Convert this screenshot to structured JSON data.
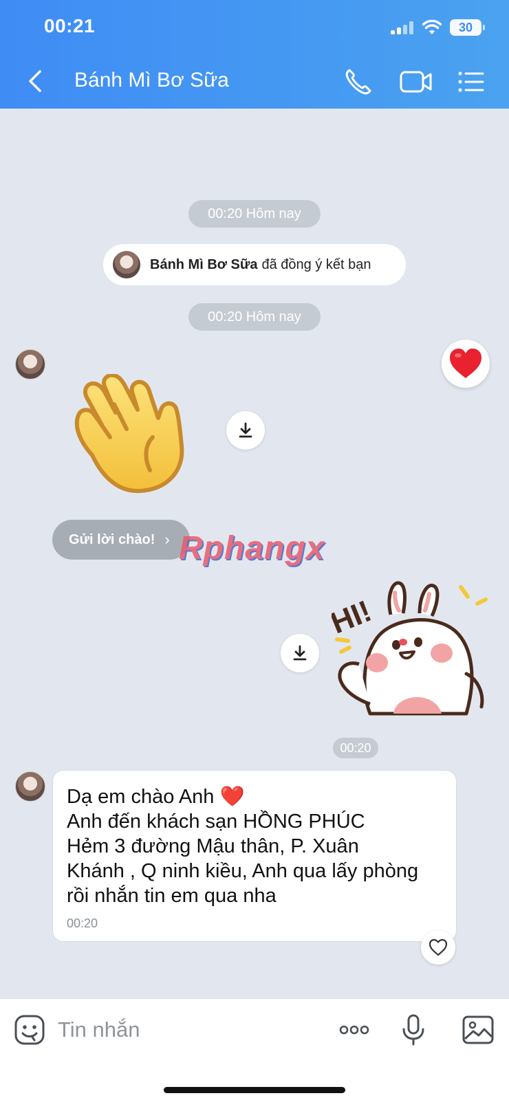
{
  "status_bar": {
    "time": "00:21",
    "battery": "30"
  },
  "header": {
    "title": "Bánh Mì Bơ Sữa"
  },
  "chat": {
    "timestamp_1": "00:20 Hôm nay",
    "friend_notice": {
      "name": "Bánh Mì Bơ Sữa",
      "text": "đã đồng ý kết bạn"
    },
    "timestamp_2": "00:20 Hôm nay",
    "wave_button_label": "Gửi lời chào!",
    "wave_button_chevron": "›",
    "sticker_hi_text": "HI!",
    "sticker_time": "00:20",
    "message": {
      "lines": [
        "Dạ em chào Anh ❤️",
        "Anh đến khách sạn HỒNG PHÚC",
        "Hẻm 3 đường Mậu thân, P. Xuân",
        "Khánh , Q ninh kiều, Anh qua lấy phòng",
        "rồi nhắn tin em qua nha"
      ],
      "time": "00:20"
    },
    "watermark": "Rphangx"
  },
  "input_bar": {
    "placeholder": "Tin nhắn"
  },
  "colors": {
    "header_start": "#3f8cf5",
    "header_end": "#4aa2f0",
    "chat_bg": "#e2e7ef"
  }
}
